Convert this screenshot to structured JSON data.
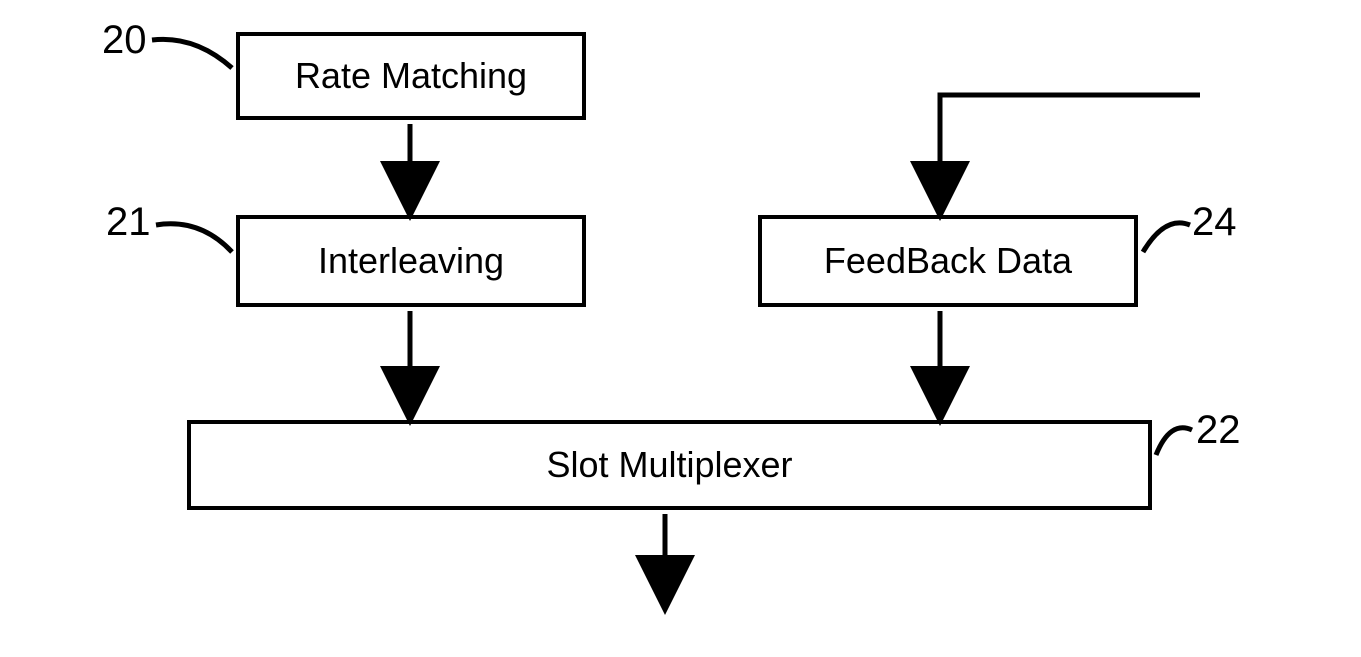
{
  "blocks": {
    "rate_matching": {
      "label": "Rate Matching",
      "ref": "20"
    },
    "interleaving": {
      "label": "Interleaving",
      "ref": "21"
    },
    "feedback": {
      "label": "FeedBack Data",
      "ref": "24"
    },
    "multiplexer": {
      "label": "Slot Multiplexer",
      "ref": "22"
    }
  },
  "chart_data": {
    "type": "diagram",
    "description": "Block diagram showing signal processing flow",
    "nodes": [
      {
        "id": "20",
        "label": "Rate Matching"
      },
      {
        "id": "21",
        "label": "Interleaving"
      },
      {
        "id": "24",
        "label": "FeedBack Data"
      },
      {
        "id": "22",
        "label": "Slot Multiplexer"
      }
    ],
    "edges": [
      {
        "from": "20",
        "to": "21"
      },
      {
        "from": "21",
        "to": "22"
      },
      {
        "from": "external",
        "to": "24"
      },
      {
        "from": "24",
        "to": "22"
      },
      {
        "from": "22",
        "to": "output"
      }
    ]
  }
}
